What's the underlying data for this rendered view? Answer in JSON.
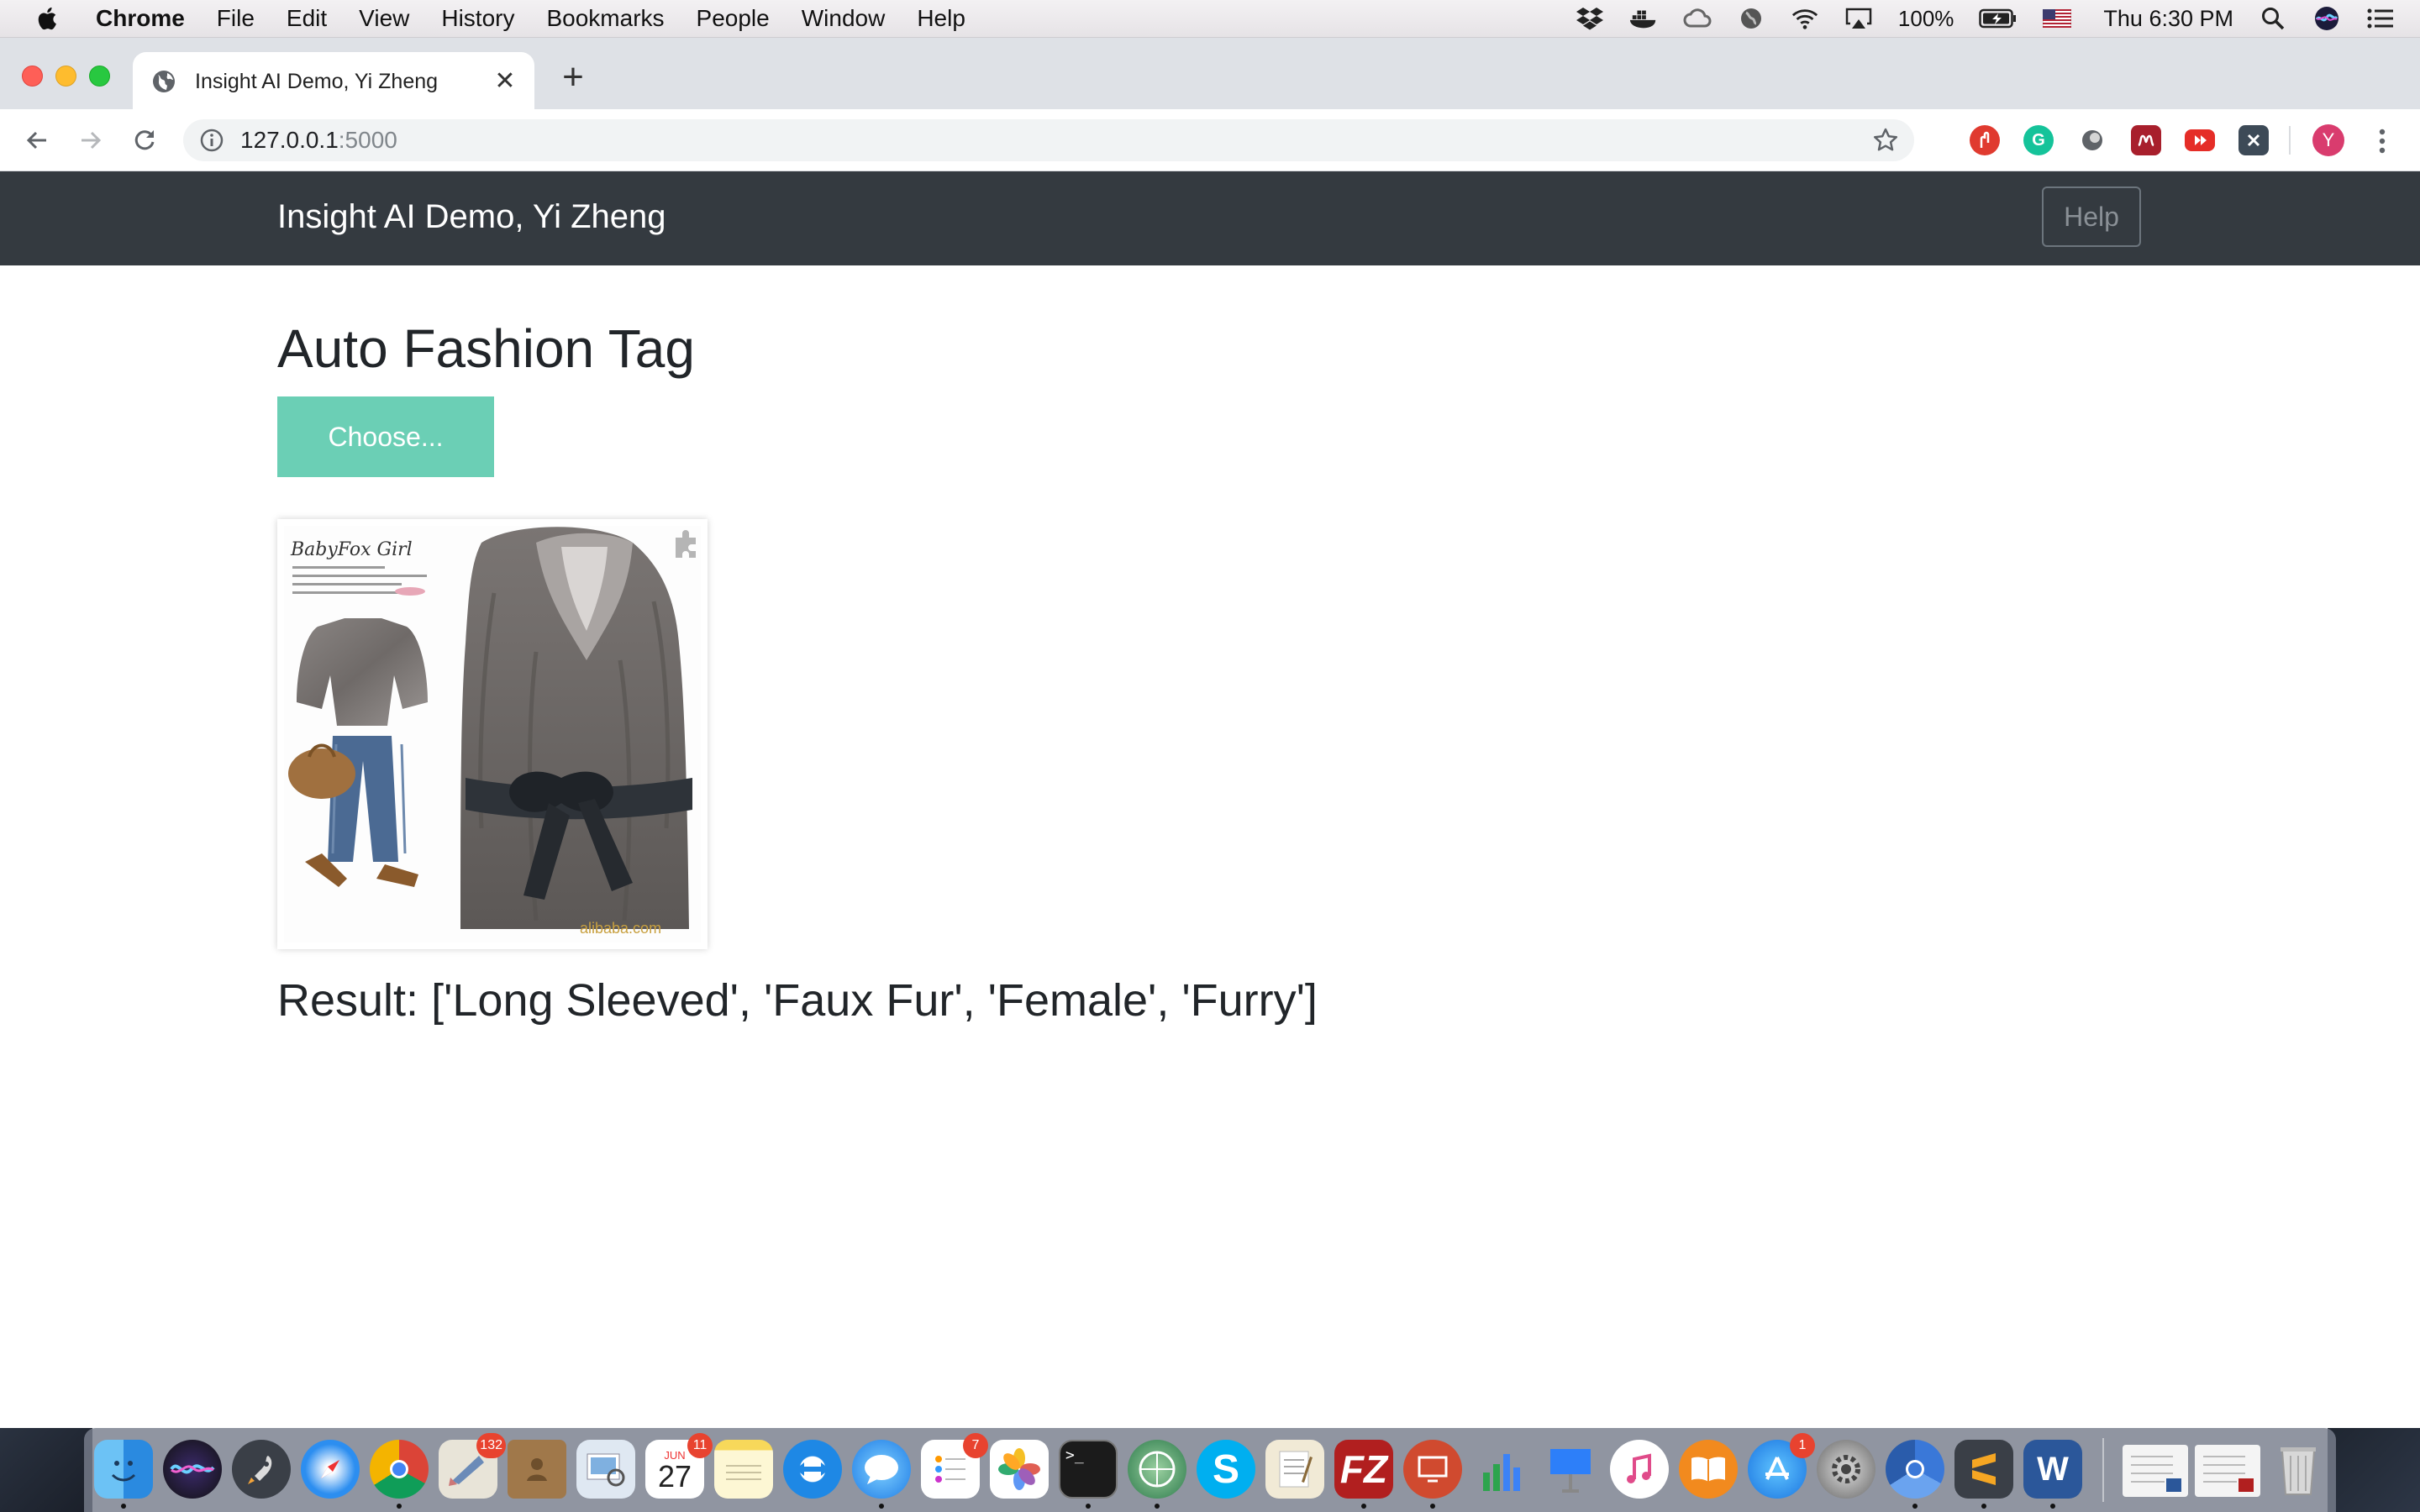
{
  "menubar": {
    "app_name": "Chrome",
    "items": [
      "File",
      "Edit",
      "View",
      "History",
      "Bookmarks",
      "People",
      "Window",
      "Help"
    ],
    "battery": "100%",
    "clock": "Thu 6:30 PM"
  },
  "browser": {
    "tab_title": "Insight AI Demo, Yi Zheng",
    "address_host": "127.0.0.1",
    "address_port": ":5000",
    "profile_initial": "Y"
  },
  "page": {
    "brand": "Insight AI Demo, Yi Zheng",
    "help_label": "Help",
    "title": "Auto Fashion Tag",
    "choose_label": "Choose...",
    "image_caption_brand": "BabyFox Girl",
    "image_watermark": "alibaba.com",
    "result": "Result: ['Long Sleeved', 'Faux Fur', 'Female', 'Furry']"
  },
  "dock": {
    "mail_badge": "132",
    "calendar_month": "JUN",
    "calendar_day": "27",
    "calendar_badge": "11",
    "reminders_badge": "7",
    "appstore_badge": "1"
  },
  "colors": {
    "navbar": "#343a40",
    "choose_button": "#6bcfb5",
    "help_border": "#6c757d",
    "avatar": "#d93c6e"
  }
}
